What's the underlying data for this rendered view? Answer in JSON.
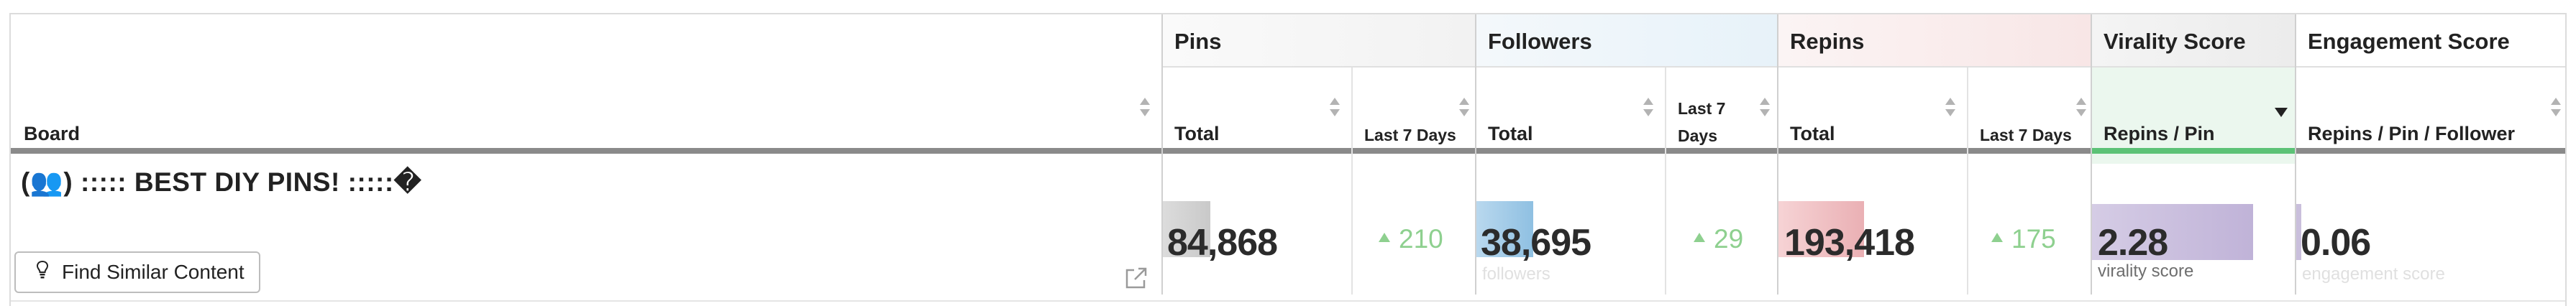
{
  "columns": {
    "board": "Board",
    "pins": {
      "group": "Pins",
      "total": "Total",
      "last7": "Last 7 Days"
    },
    "followers": {
      "group": "Followers",
      "total": "Total",
      "last7_line1": "Last 7",
      "last7_line2": "Days"
    },
    "repins": {
      "group": "Repins",
      "total": "Total",
      "last7": "Last 7 Days"
    },
    "virality": {
      "group": "Virality Score",
      "sub": "Repins / Pin"
    },
    "engagement": {
      "group": "Engagement Score",
      "sub": "Repins / Pin / Follower"
    }
  },
  "sorted_column": "Repins / Pin",
  "sort_direction": "descending",
  "row": {
    "board_name": "(👥) ::::: BEST DIY PINS! :::::�",
    "find_similar_label": "Find Similar Content",
    "pins_total": "84,868",
    "pins_last7": "210",
    "followers_total": "38,695",
    "followers_faint_label": "followers",
    "followers_last7": "29",
    "repins_total": "193,418",
    "repins_last7": "175",
    "virality_value": "2.28",
    "virality_label": "virality score",
    "engagement_value": "0.06",
    "engagement_label": "engagement score"
  },
  "bar_levels": {
    "pins": 0.25,
    "followers": 0.3,
    "repins": 0.45,
    "virality": 1.0,
    "engagement": 0.03
  },
  "colors": {
    "pins_bar": "#cfcfcf",
    "followers_bar": "#a9cde6",
    "repins_bar": "#f1c4c7",
    "virality_bar": "#c9bfdc",
    "engagement_bar": "#c9bfdc",
    "delta_green": "#8ed08f",
    "sort_active_underline": "#5cc276"
  },
  "icons": [
    "sort-icon",
    "lightbulb-icon",
    "external-link-icon",
    "up-triangle-icon"
  ]
}
